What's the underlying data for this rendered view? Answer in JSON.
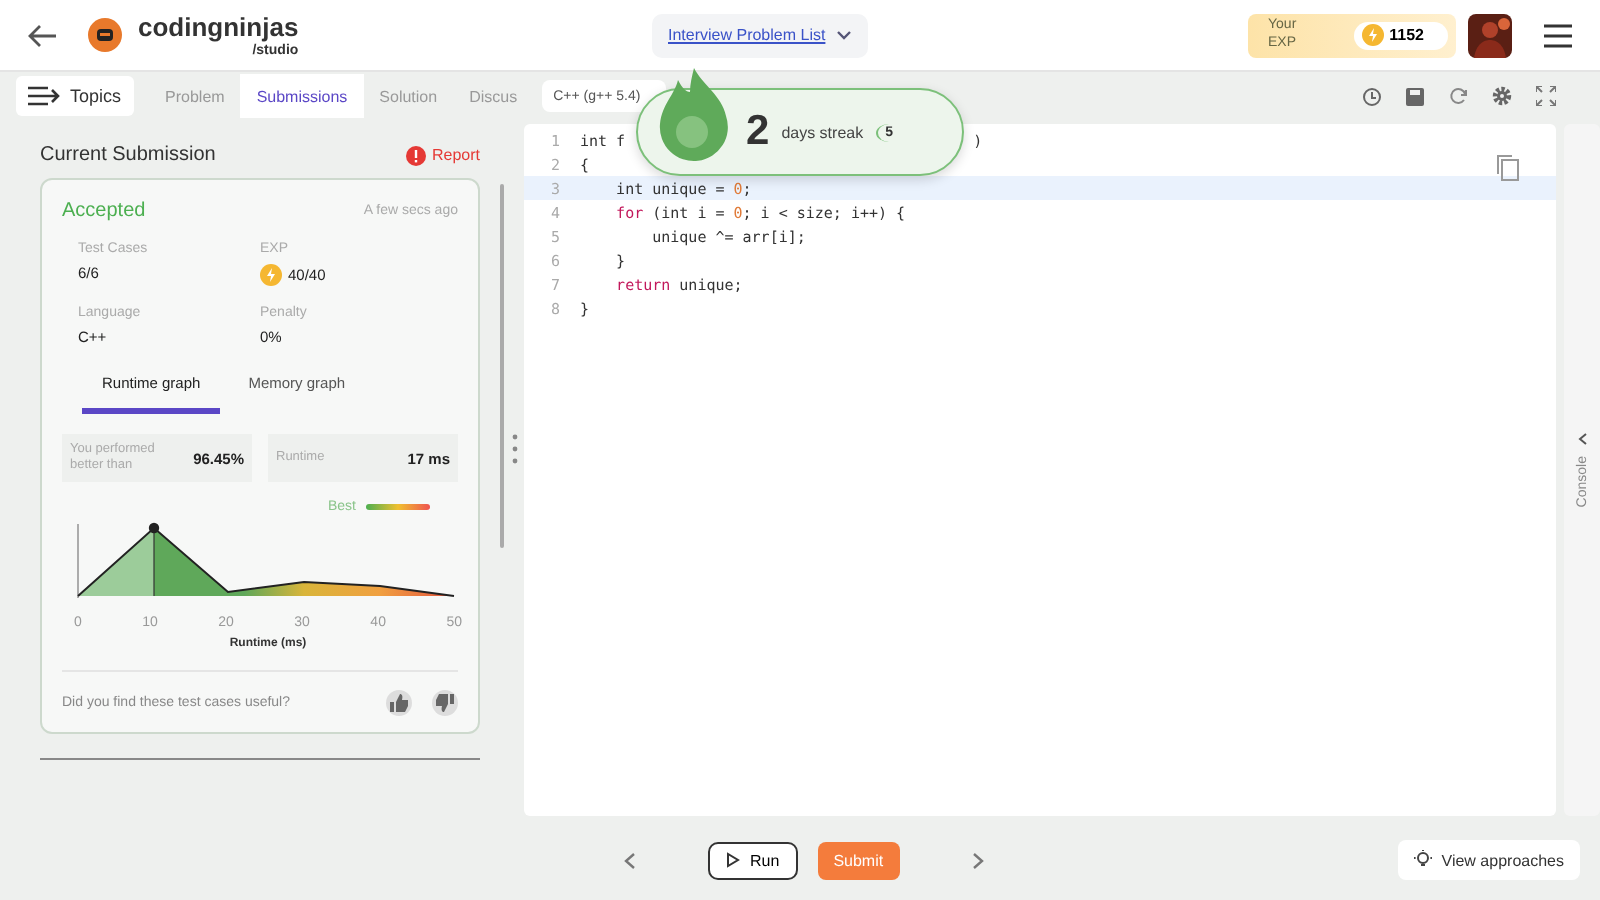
{
  "header": {
    "logo": {
      "name": "codingninjas",
      "sub": "/studio"
    },
    "problem_list": "Interview Problem List",
    "exp": {
      "label": "Your EXP",
      "value": "1152"
    }
  },
  "tabs_bar": {
    "topics": "Topics",
    "tabs": [
      {
        "label": "Problem",
        "selected": false
      },
      {
        "label": "Submissions",
        "selected": true
      },
      {
        "label": "Solution",
        "selected": false
      },
      {
        "label": "Discus",
        "selected": false
      }
    ],
    "language": "C++ (g++ 5.4)"
  },
  "streak": {
    "count": "2",
    "label": "days streak",
    "badge": "5"
  },
  "submission": {
    "title": "Current Submission",
    "report": "Report",
    "status": "Accepted",
    "time": "A few secs ago",
    "stats": [
      {
        "label": "Test Cases",
        "value": "6/6",
        "kind": "plain"
      },
      {
        "label": "EXP",
        "value": "40/40",
        "kind": "exp"
      },
      {
        "label": "Language",
        "value": "C++",
        "kind": "plain"
      },
      {
        "label": "Penalty",
        "value": "0%",
        "kind": "plain"
      }
    ],
    "graph_tabs": [
      {
        "label": "Runtime graph",
        "selected": true
      },
      {
        "label": "Memory graph",
        "selected": false
      }
    ],
    "performance": {
      "label": "You performed better than",
      "value": "96.45%"
    },
    "runtime": {
      "label": "Runtime",
      "value": "17 ms"
    },
    "graph": {
      "legend": "Best",
      "ticks": [
        "0",
        "10",
        "20",
        "30",
        "40",
        "50"
      ],
      "xlabel": "Runtime (ms)"
    },
    "feedback": "Did you find these test cases useful?"
  },
  "editor": {
    "lines": [
      {
        "number": "1",
        "segments": [
          {
            "text": "int f",
            "kind": "plain"
          }
        ],
        "tail": ")",
        "highlighted": false
      },
      {
        "number": "2",
        "segments": [
          {
            "text": "{",
            "kind": "plain"
          }
        ],
        "highlighted": false
      },
      {
        "number": "3",
        "segments": [
          {
            "text": "    int unique = ",
            "kind": "plain"
          },
          {
            "text": "0",
            "kind": "num"
          },
          {
            "text": ";",
            "kind": "plain"
          }
        ],
        "highlighted": true
      },
      {
        "number": "4",
        "segments": [
          {
            "text": "    for",
            "kind": "kw"
          },
          {
            "text": " (int i = ",
            "kind": "plain"
          },
          {
            "text": "0",
            "kind": "num"
          },
          {
            "text": "; i < size; i++) {",
            "kind": "plain"
          }
        ],
        "highlighted": false
      },
      {
        "number": "5",
        "segments": [
          {
            "text": "        unique ^= arr[i];",
            "kind": "plain"
          }
        ],
        "highlighted": false
      },
      {
        "number": "6",
        "segments": [
          {
            "text": "    }",
            "kind": "plain"
          }
        ],
        "highlighted": false
      },
      {
        "number": "7",
        "segments": [
          {
            "text": "    return",
            "kind": "kw"
          },
          {
            "text": " unique;",
            "kind": "plain"
          }
        ],
        "highlighted": false
      },
      {
        "number": "8",
        "segments": [
          {
            "text": "}",
            "kind": "plain"
          }
        ],
        "highlighted": false
      }
    ]
  },
  "console": "Console",
  "bottom": {
    "run": "Run",
    "submit": "Submit",
    "approaches": "View approaches"
  }
}
